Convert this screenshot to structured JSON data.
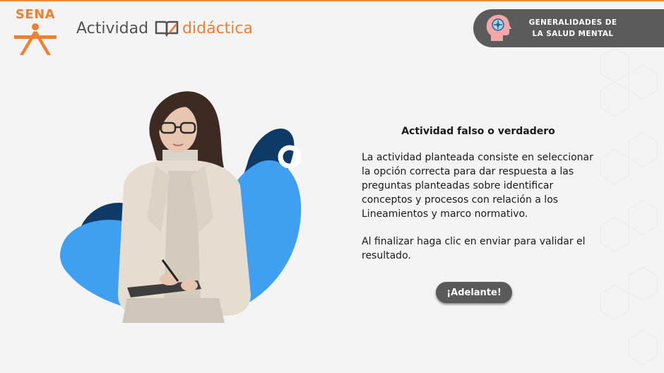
{
  "brand": {
    "logo_text": "SENA",
    "activity_label": "Actividad",
    "didactic_label": "didáctica",
    "brand_orange": "#f07f2f"
  },
  "topic": {
    "line1": "GENERALIDADES DE",
    "line2": "LA SALUD MENTAL",
    "icon": "brain-head-icon",
    "pill_color": "#5b5b5b"
  },
  "activity": {
    "title": "Actividad falso o verdadero",
    "description": "La actividad planteada consiste en seleccionar la opción correcta para dar respuesta a las preguntas planteadas sobre identificar conceptos y procesos con relación a los Lineamientos y marco normativo.",
    "instruction": "Al finalizar haga clic en enviar para validar el resultado."
  },
  "actions": {
    "next_label": "¡Adelante!"
  },
  "colors": {
    "blob_light": "#3fa0f2",
    "blob_dark": "#0f3a66",
    "button": "#5a5a5a"
  }
}
